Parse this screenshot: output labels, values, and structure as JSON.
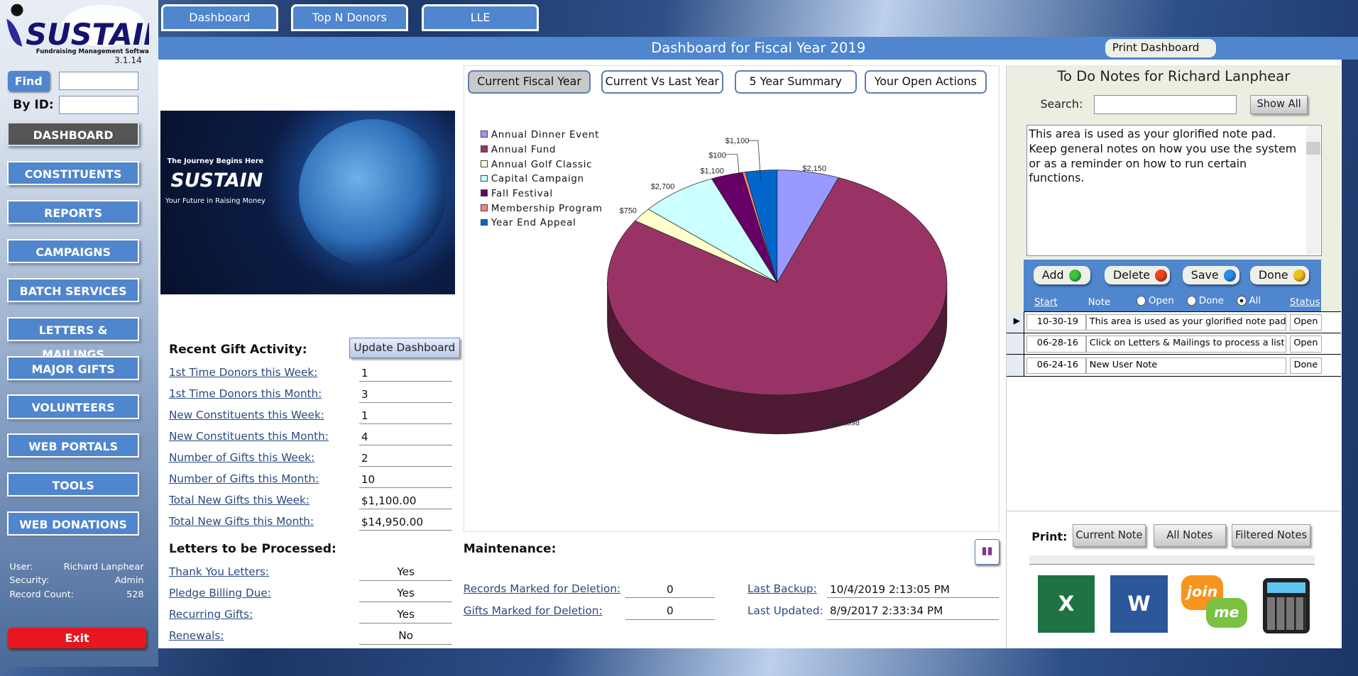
{
  "app": {
    "version": "3.1.14",
    "logo_text": "SUSTAIN",
    "logo_tagline": "Fundraising Management Software"
  },
  "top_tabs": [
    "Dashboard",
    "Top N Donors",
    "LLE"
  ],
  "sidebar": {
    "find_label": "Find",
    "byid_label": "By ID:",
    "find_value": "",
    "byid_value": "",
    "items": [
      "DASHBOARD",
      "CONSTITUENTS",
      "REPORTS",
      "CAMPAIGNS",
      "BATCH SERVICES",
      "LETTERS & MAILINGS",
      "MAJOR GIFTS",
      "VOLUNTEERS",
      "WEB PORTALS",
      "TOOLS",
      "WEB DONATIONS"
    ],
    "active": "DASHBOARD",
    "user_label": "User:",
    "user": "Richard Lanphear",
    "security_label": "Security:",
    "security": "Admin",
    "count_label": "Record Count:",
    "count": "528",
    "exit": "Exit"
  },
  "header": {
    "title": "Dashboard for Fiscal Year 2019",
    "print": "Print Dashboard"
  },
  "hero": {
    "line1": "The Journey Begins Here",
    "brand": "SUSTAIN",
    "line2": "Your Future in Raising Money"
  },
  "recent": {
    "title": "Recent Gift Activity:",
    "update_btn": "Update Dashboard",
    "rows": [
      {
        "label": "1st Time Donors this Week:",
        "value": "1"
      },
      {
        "label": "1st Time Donors this Month:",
        "value": "3"
      },
      {
        "label": "New Constituents this Week:",
        "value": "1"
      },
      {
        "label": "New Constituents this Month:",
        "value": "4"
      },
      {
        "label": "Number of Gifts this Week:",
        "value": "2"
      },
      {
        "label": "Number of Gifts this Month:",
        "value": "10"
      },
      {
        "label": "Total New Gifts this Week:",
        "value": "$1,100.00"
      },
      {
        "label": "Total New Gifts this Month:",
        "value": "$14,950.00"
      }
    ]
  },
  "letters": {
    "title": "Letters to be Processed:",
    "rows": [
      {
        "label": "Thank You Letters:",
        "value": "Yes"
      },
      {
        "label": "Pledge Billing Due:",
        "value": "Yes"
      },
      {
        "label": "Recurring Gifts:",
        "value": "Yes"
      },
      {
        "label": "Renewals:",
        "value": "No"
      }
    ]
  },
  "chart_tabs": [
    "Current Fiscal Year",
    "Current Vs Last Year",
    "5 Year Summary",
    "Your Open Actions"
  ],
  "chart_tab_active": "Current Fiscal Year",
  "chart_data": {
    "type": "pie",
    "style": "3d",
    "legend_position": "left",
    "categories": [
      "Annual Dinner Event",
      "Annual Fund",
      "Annual Golf Classic",
      "Capital Campaign",
      "Fall Festival",
      "Membership Program",
      "Year End Appeal"
    ],
    "values": [
      2150,
      28598,
      750,
      2700,
      1100,
      100,
      1100
    ],
    "labels": [
      "$2,150",
      "$28,598",
      "$750",
      "$2,700",
      "$1,100",
      "$100",
      "$1,100"
    ],
    "colors": [
      "#9999ff",
      "#993366",
      "#ffffcc",
      "#ccffff",
      "#660066",
      "#ff8080",
      "#0066cc"
    ]
  },
  "maintenance": {
    "title": "Maintenance:",
    "rows": [
      {
        "label": "Records Marked for Deletion:",
        "value": "0"
      },
      {
        "label": "Gifts Marked for Deletion:",
        "value": "0"
      }
    ],
    "backup_label": "Last Backup:",
    "backup": "10/4/2019 2:13:05 PM",
    "updated_label": "Last Updated:",
    "updated": "8/9/2017 2:33:34 PM"
  },
  "todo": {
    "title": "To Do Notes for Richard Lanphear",
    "search_label": "Search:",
    "search_value": "",
    "show_all": "Show All",
    "note_text": "This area is used as your glorified note pad.  Keep general notes on how you use the system or as a reminder on how to run certain functions.",
    "buttons": [
      {
        "label": "Add",
        "color": "#3cc43c"
      },
      {
        "label": "Delete",
        "color": "#ee4422"
      },
      {
        "label": "Save",
        "color": "#2a8ee8"
      },
      {
        "label": "Done",
        "color": "#f0c020"
      }
    ],
    "col_start": "Start",
    "col_note": "Note",
    "filters": [
      "Open",
      "Done",
      "All"
    ],
    "filter_selected": "All",
    "col_status": "Status",
    "rows": [
      {
        "start": "10-30-19",
        "note": "This area is used as your glorified note pad.  Keep",
        "status": "Open"
      },
      {
        "start": "06-28-16",
        "note": "Click on Letters & Mailings to process a list",
        "status": "Open"
      },
      {
        "start": "06-24-16",
        "note": "New User Note",
        "status": "Done"
      }
    ],
    "print_label": "Print:",
    "print_buttons": [
      "Current Note",
      "All Notes",
      "Filtered Notes"
    ],
    "apps": [
      "excel",
      "word",
      "join.me",
      "calculator"
    ],
    "join_text1": "join",
    "join_text2": "me"
  }
}
